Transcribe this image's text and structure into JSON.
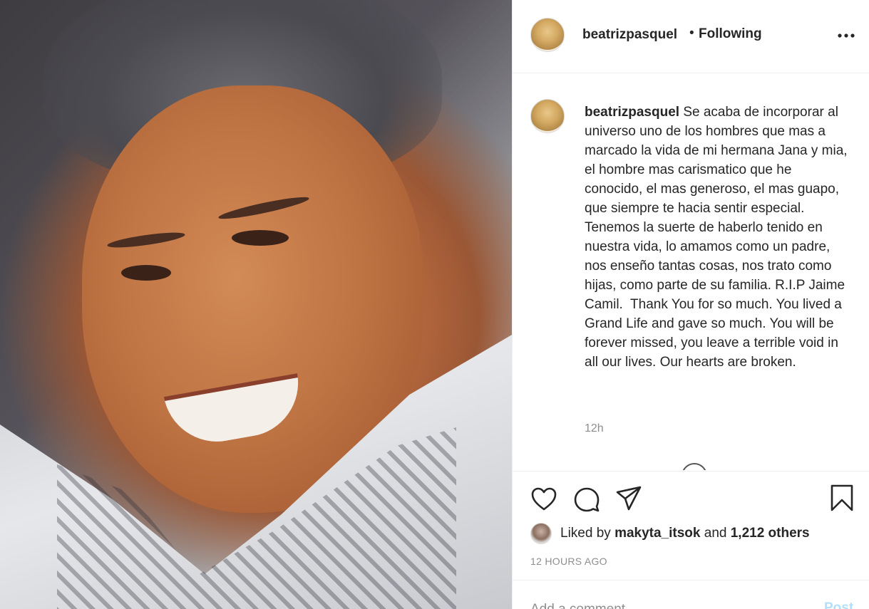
{
  "header": {
    "username": "beatrizpasquel",
    "separator": "•",
    "follow_label": "Following",
    "more_icon": "more-horizontal-icon"
  },
  "caption": {
    "username": "beatrizpasquel",
    "text": "Se acaba de incorporar al universo uno de los hombres que mas a marcado la vida de mi hermana Jana y mia, el hombre mas carismatico que he conocido, el mas generoso, el mas guapo, que siempre te hacia sentir especial. Tenemos la suerte de haberlo tenido en nuestra vida, lo amamos como un padre, nos enseño tantas cosas, nos trato como hijas, como parte de su familia. R.I.P Jaime Camil.  Thank You for so much. You lived a Grand Life and gave so much. You will be forever missed, you leave a terrible void in all our lives. Our hearts are broken.",
    "relative_time": "12h"
  },
  "actions": {
    "like_icon": "heart-icon",
    "comment_icon": "comment-bubble-icon",
    "share_icon": "paper-plane-icon",
    "save_icon": "bookmark-icon"
  },
  "likes": {
    "prefix": "Liked by",
    "liker": "makyta_itsok",
    "conjunction": "and",
    "others": "1,212 others"
  },
  "timestamp": "12 HOURS AGO",
  "add_comment": {
    "placeholder": "Add a comment…",
    "post_label": "Post"
  },
  "colors": {
    "text": "#262626",
    "muted": "#8e8e8e",
    "divider": "#efefef",
    "post_button_disabled": "#b2dffc"
  }
}
